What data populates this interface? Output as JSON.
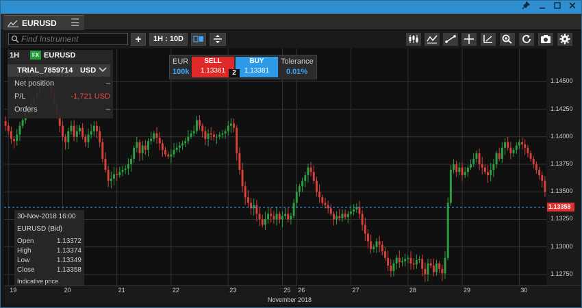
{
  "window": {
    "pin_icon": "pin-icon",
    "minimize_icon": "minimize-icon",
    "maximize_icon": "maximize-icon",
    "close_icon": "close-icon"
  },
  "tab": {
    "name": "EURUSD",
    "icon": "line-chart-icon",
    "menu_icon": "hamburger-icon"
  },
  "toolbar": {
    "search_placeholder": "Find Instrument",
    "add_label": "+",
    "timeframe_label": "1H : 10D",
    "tools": [
      "candles-icon",
      "indicator-icon",
      "drawing-line-icon",
      "crosshair-icon",
      "draw-tools-icon",
      "zoom-icon",
      "refresh-icon",
      "camera-icon",
      "gear-icon"
    ]
  },
  "header": {
    "timeframe": "1H",
    "fx_badge": "FX",
    "symbol": "EURUSD"
  },
  "account": {
    "name": "TRIAL_7859714",
    "currency": "USD",
    "rows": [
      {
        "label": "Net position",
        "value": "–"
      },
      {
        "label": "P/L",
        "value": "-1,721 USD"
      },
      {
        "label": "Orders",
        "value": "–"
      }
    ]
  },
  "trade": {
    "currency": "EUR",
    "amount": "100k",
    "sell_label": "SELL",
    "sell_price": "1.13361",
    "buy_label": "BUY",
    "buy_price": "1.13381",
    "spread": "2",
    "tolerance_label": "Tolerance",
    "tolerance_value": "0.01%"
  },
  "info": {
    "date": "30-Nov-2018 16:00",
    "symbol": "EURUSD (Bid)",
    "rows": [
      {
        "label": "Open",
        "value": "1.13372"
      },
      {
        "label": "High",
        "value": "1.13374"
      },
      {
        "label": "Low",
        "value": "1.13349"
      },
      {
        "label": "Close",
        "value": "1.13358"
      }
    ],
    "note": "Indicative price"
  },
  "colors": {
    "up": "#2ea043",
    "down": "#d9423a",
    "current": "#e03030",
    "accent": "#2f8fd0"
  },
  "chart_data": {
    "type": "candlestick",
    "current_price": 1.13358,
    "current_price_label": "1.13358",
    "ylim": [
      1.1265,
      1.148
    ],
    "y_ticks": [
      "1.12750",
      "1.13000",
      "1.13250",
      "1.13500",
      "1.13750",
      "1.14000",
      "1.14250",
      "1.14500"
    ],
    "y_tick_values": [
      1.1275,
      1.13,
      1.1325,
      1.135,
      1.1375,
      1.14,
      1.1425,
      1.145
    ],
    "x_ticks": [
      "19",
      "20",
      "21",
      "22",
      "23",
      "25",
      "26",
      "27",
      "28",
      "29",
      "30"
    ],
    "x_tick_bars": [
      1,
      20,
      39,
      58,
      78,
      97,
      102,
      121,
      141,
      160,
      180
    ],
    "month_label": "November 2018",
    "bar_count": 190,
    "closes": [
      1.141,
      1.1405,
      1.1398,
      1.1396,
      1.1402,
      1.141,
      1.1415,
      1.142,
      1.1425,
      1.143,
      1.1435,
      1.144,
      1.1445,
      1.1448,
      1.1452,
      1.1447,
      1.144,
      1.143,
      1.142,
      1.141,
      1.14,
      1.1395,
      1.1405,
      1.141,
      1.14,
      1.1405,
      1.1408,
      1.14,
      1.1395,
      1.1402,
      1.1405,
      1.141,
      1.1405,
      1.1395,
      1.138,
      1.137,
      1.136,
      1.1362,
      1.1366,
      1.1365,
      1.1368,
      1.137,
      1.1371,
      1.1375,
      1.138,
      1.139,
      1.1395,
      1.1385,
      1.1392,
      1.1388,
      1.1396,
      1.1398,
      1.1403,
      1.1399,
      1.1394,
      1.1388,
      1.1384,
      1.1382,
      1.1384,
      1.1388,
      1.139,
      1.1392,
      1.1394,
      1.1396,
      1.14,
      1.1403,
      1.1405,
      1.1415,
      1.141,
      1.1405,
      1.1398,
      1.1403,
      1.1402,
      1.14,
      1.14,
      1.1402,
      1.1403,
      1.1405,
      1.141,
      1.1412,
      1.1408,
      1.1385,
      1.137,
      1.1355,
      1.1345,
      1.134,
      1.1335,
      1.1338,
      1.133,
      1.1325,
      1.132,
      1.1325,
      1.133,
      1.1328,
      1.1325,
      1.133,
      1.1325,
      1.1328,
      1.133,
      1.1325,
      1.1328,
      1.134,
      1.135,
      1.1355,
      1.136,
      1.1365,
      1.1372,
      1.1368,
      1.136,
      1.135,
      1.1345,
      1.134,
      1.1338,
      1.1335,
      1.133,
      1.1325,
      1.1328,
      1.1326,
      1.133,
      1.1327,
      1.133,
      1.1332,
      1.1334,
      1.1336,
      1.133,
      1.132,
      1.1312,
      1.1305,
      1.1298,
      1.13,
      1.1305,
      1.1302,
      1.1296,
      1.129,
      1.1283,
      1.1278,
      1.1285,
      1.129,
      1.1286,
      1.1287,
      1.1289,
      1.129,
      1.1285,
      1.1284,
      1.1288,
      1.1289,
      1.128,
      1.1275,
      1.1285,
      1.1283,
      1.1277,
      1.1285,
      1.128,
      1.1276,
      1.129,
      1.134,
      1.137,
      1.1375,
      1.1368,
      1.1372,
      1.1365,
      1.1368,
      1.1372,
      1.1375,
      1.138,
      1.1385,
      1.1375,
      1.1372,
      1.1368,
      1.1365,
      1.137,
      1.1375,
      1.1385,
      1.138,
      1.139,
      1.1395,
      1.139,
      1.1385,
      1.1388,
      1.1392,
      1.1395,
      1.1393,
      1.139,
      1.1385,
      1.138,
      1.1375,
      1.137,
      1.1365,
      1.136,
      1.135,
      1.1336
    ]
  }
}
